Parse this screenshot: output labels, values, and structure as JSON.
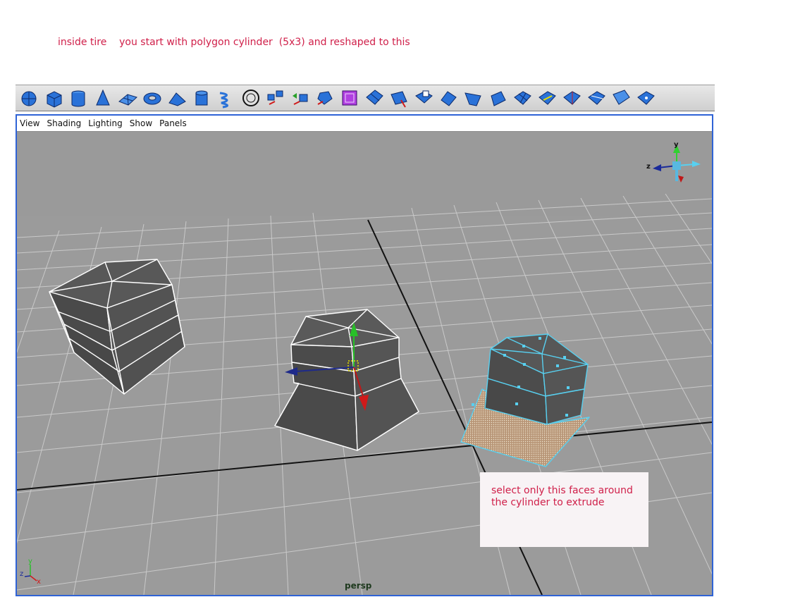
{
  "caption": "inside tire    you start with polygon cylinder  (5x3) and reshaped to this",
  "toolbar": {
    "icons": [
      "sphere-icon",
      "cube-icon",
      "cylinder-icon",
      "cone-icon",
      "plane-icon",
      "torus-icon",
      "prism-icon",
      "pipe-icon",
      "helix-icon",
      "soccer-ball-icon",
      "combine-icon",
      "separate-icon",
      "extract-icon",
      "smooth-icon",
      "boolean-icon",
      "mirror-icon",
      "split-polygon-icon",
      "extrude-face-icon",
      "extrude-edge-icon",
      "bevel-icon",
      "poke-icon",
      "wedge-icon",
      "append-polygon-icon",
      "interactive-split-icon",
      "cut-faces-icon",
      "merge-icon"
    ]
  },
  "menu": [
    "View",
    "Shading",
    "Lighting",
    "Show",
    "Panels"
  ],
  "view_cube": {
    "y_label": "y",
    "z_label": "z"
  },
  "axis_indicator": {
    "y": "y",
    "z": "z",
    "x": "x"
  },
  "camera_label": "persp",
  "note": "select only this faces around\nthe cylinder to extrude",
  "colors": {
    "caption": "#d0204a",
    "panel_border": "#2f63d6",
    "viewport_bg": "#9b9b9b",
    "selection": "#58d0f0"
  }
}
